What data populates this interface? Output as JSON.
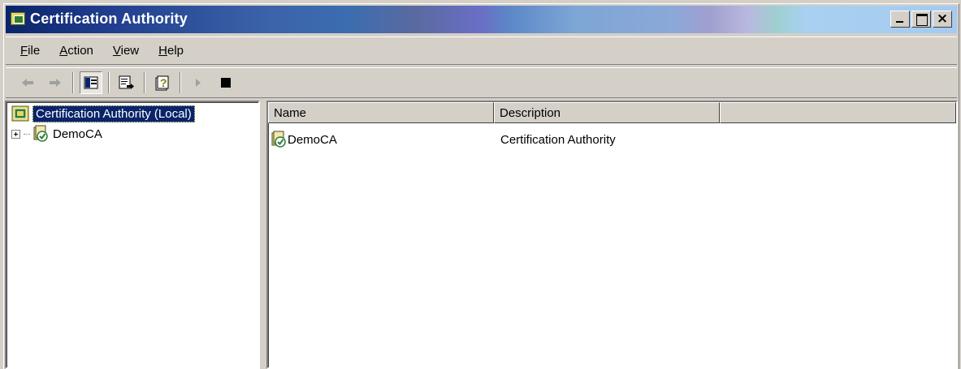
{
  "window": {
    "title": "Certification Authority",
    "icon": "certsrv-console-icon"
  },
  "menu": {
    "items": [
      {
        "label": "File",
        "accel": "F",
        "rest": "ile"
      },
      {
        "label": "Action",
        "accel": "A",
        "rest": "ction"
      },
      {
        "label": "View",
        "accel": "V",
        "rest": "iew"
      },
      {
        "label": "Help",
        "accel": "H",
        "rest": "elp"
      }
    ]
  },
  "toolbar": {
    "buttons": [
      "back-icon",
      "forward-icon",
      "show-hide-tree-icon",
      "export-list-icon",
      "help-icon",
      "start-service-icon",
      "stop-service-icon"
    ]
  },
  "tree": {
    "root_label": "Certification Authority (Local)",
    "child_label": "DemoCA"
  },
  "list": {
    "columns": [
      "Name",
      "Description",
      ""
    ],
    "rows": [
      {
        "name": "DemoCA",
        "description": "Certification Authority"
      }
    ]
  }
}
